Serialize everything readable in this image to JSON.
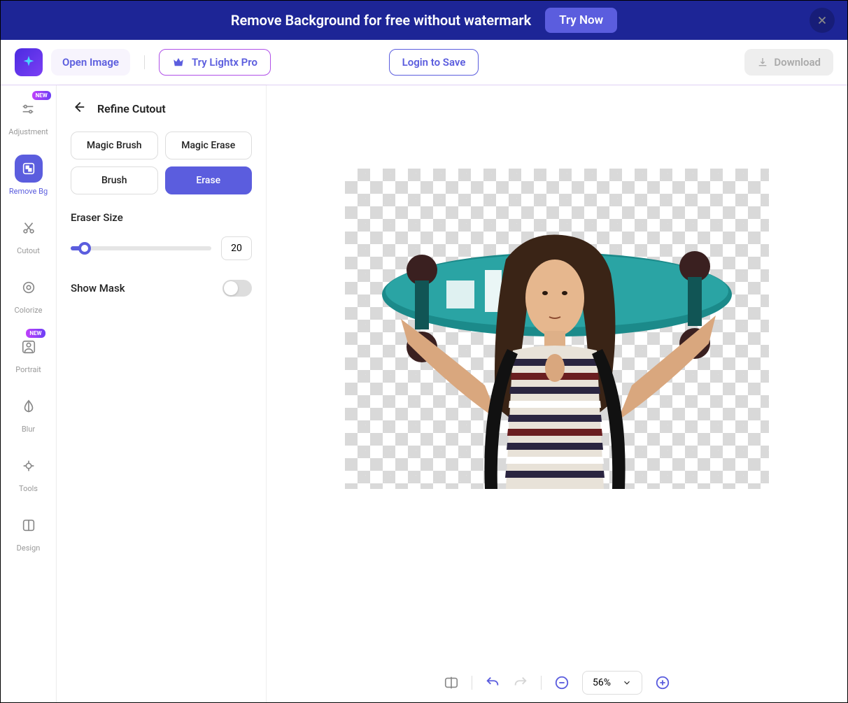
{
  "banner": {
    "text": "Remove Background for free without watermark",
    "cta": "Try Now"
  },
  "topbar": {
    "open_image": "Open Image",
    "try_pro": "Try Lightx Pro",
    "login_save": "Login to Save",
    "download": "Download"
  },
  "rail": {
    "items": [
      {
        "label": "Adjustment",
        "new": true,
        "active": false
      },
      {
        "label": "Remove Bg",
        "new": false,
        "active": true
      },
      {
        "label": "Cutout",
        "new": false,
        "active": false
      },
      {
        "label": "Colorize",
        "new": false,
        "active": false
      },
      {
        "label": "Portrait",
        "new": true,
        "active": false
      },
      {
        "label": "Blur",
        "new": false,
        "active": false
      },
      {
        "label": "Tools",
        "new": false,
        "active": false
      },
      {
        "label": "Design",
        "new": false,
        "active": false
      }
    ],
    "badge": "NEW"
  },
  "panel": {
    "title": "Refine Cutout",
    "tools": [
      {
        "label": "Magic Brush",
        "active": false
      },
      {
        "label": "Magic Erase",
        "active": false
      },
      {
        "label": "Brush",
        "active": false
      },
      {
        "label": "Erase",
        "active": true
      }
    ],
    "eraser_label": "Eraser Size",
    "eraser_value": "20",
    "show_mask_label": "Show Mask",
    "show_mask_on": false
  },
  "bottombar": {
    "zoom": "56%"
  }
}
